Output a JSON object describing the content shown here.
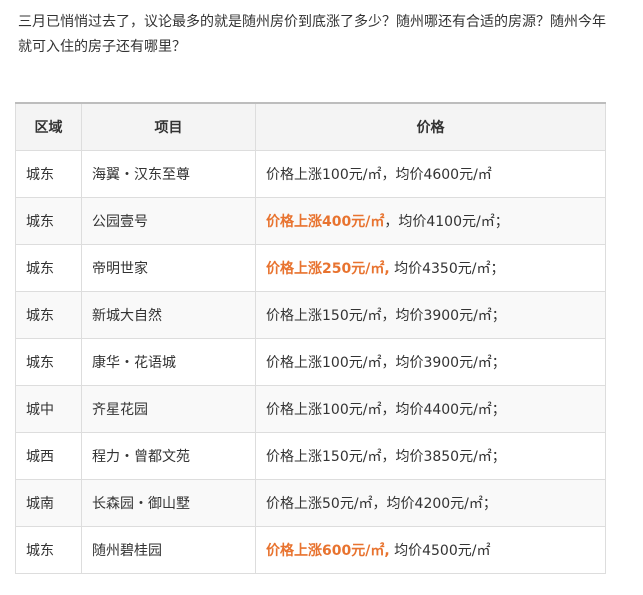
{
  "intro": {
    "line1": "三月已悄悄过去了，议论最多的就是随州房价到底涨了多少？随州哪还有合适的房源？随州今年",
    "line2": "就可入住的房子还有哪里？"
  },
  "table": {
    "headers": [
      "区域",
      "项目",
      "价格"
    ],
    "highlight_color": "#e8732f",
    "rows": [
      {
        "area": "城东",
        "project": "海翼・汉东至尊",
        "rise": "价格上涨100元/㎡",
        "avg": "，均价4600元/㎡",
        "highlight": false
      },
      {
        "area": "城东",
        "project": "公园壹号",
        "rise": "价格上涨400元/㎡",
        "avg": "，均价4100元/㎡；",
        "highlight": true
      },
      {
        "area": "城东",
        "project": "帝明世家",
        "rise": "价格上涨250元/㎡,",
        "avg": " 均价4350元/㎡；",
        "highlight": true
      },
      {
        "area": "城东",
        "project": "新城大自然",
        "rise": "价格上涨150元/㎡",
        "avg": "，均价3900元/㎡；",
        "highlight": false
      },
      {
        "area": "城东",
        "project": "康华・花语城",
        "rise": "价格上涨100元/㎡",
        "avg": "，均价3900元/㎡；",
        "highlight": false
      },
      {
        "area": "城中",
        "project": "齐星花园",
        "rise": "价格上涨100元/㎡",
        "avg": "，均价4400元/㎡；",
        "highlight": false
      },
      {
        "area": "城西",
        "project": "程力・曾都文苑",
        "rise": "价格上涨150元/㎡",
        "avg": "，均价3850元/㎡；",
        "highlight": false
      },
      {
        "area": "城南",
        "project": "长森园・御山墅",
        "rise": "价格上涨50元/㎡",
        "avg": "，均价4200元/㎡；",
        "highlight": false
      },
      {
        "area": "城东",
        "project": "随州碧桂园",
        "rise": "价格上涨600元/㎡,",
        "avg": " 均价4500元/㎡",
        "highlight": true
      }
    ]
  }
}
